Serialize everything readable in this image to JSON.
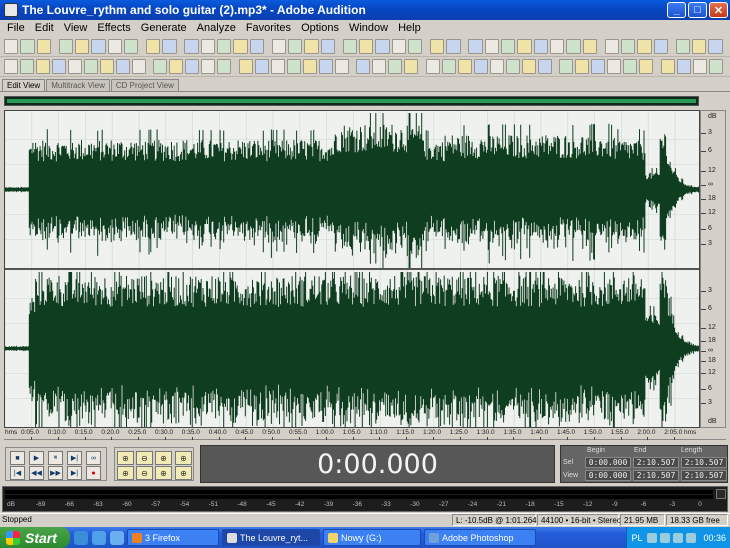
{
  "window": {
    "title": "The Louvre_rythm and solo guitar (2).mp3* - Adobe Audition",
    "minimize": "_",
    "maximize": "□",
    "close": "✕"
  },
  "menu": [
    "File",
    "Edit",
    "View",
    "Effects",
    "Generate",
    "Analyze",
    "Favorites",
    "Options",
    "Window",
    "Help"
  ],
  "tabs": [
    {
      "label": "Edit View",
      "active": true
    },
    {
      "label": "Multitrack View",
      "active": false
    },
    {
      "label": "CD Project View",
      "active": false
    }
  ],
  "waveform": {
    "color": "#0f3d1f",
    "background": "#eef1ee",
    "channels": [
      "left",
      "right"
    ]
  },
  "db_ruler": {
    "unit": "dB",
    "left_channel": [
      "3",
      "6",
      "12",
      "∞",
      "18",
      "12",
      "6",
      "3"
    ],
    "right_channel": [
      "3",
      "6",
      "12",
      "18",
      "∞",
      "18",
      "12",
      "6",
      "3"
    ]
  },
  "time_ruler": {
    "start": "hms",
    "end": "hms",
    "labels": [
      "0:05.0",
      "0:10.0",
      "0:15.0",
      "0:20.0",
      "0:25.0",
      "0:30.0",
      "0:35.0",
      "0:40.0",
      "0:45.0",
      "0:50.0",
      "0:55.0",
      "1:00.0",
      "1:05.0",
      "1:10.0",
      "1:15.0",
      "1:20.0",
      "1:25.0",
      "1:30.0",
      "1:35.0",
      "1:40.0",
      "1:45.0",
      "1:50.0",
      "1:55.0",
      "2:00.0",
      "2:05.0"
    ]
  },
  "transport": {
    "row1": [
      "■",
      "▶",
      "⏸",
      "▶|",
      "∞"
    ],
    "row2": [
      "|◀",
      "◀◀",
      "▶▶",
      "▶|",
      "●"
    ]
  },
  "zoom": {
    "row1": [
      "⊕",
      "⊖",
      "⊕",
      "⊕"
    ],
    "row2": [
      "⊕",
      "⊖",
      "⊕",
      "⊕"
    ]
  },
  "time_display": "0:00.000",
  "selection": {
    "headers": {
      "begin": "Begin",
      "end": "End",
      "length": "Length"
    },
    "sel": {
      "label": "Sel",
      "begin": "0:00.000",
      "end": "2:10.507",
      "length": "2:10.507"
    },
    "view": {
      "label": "View",
      "begin": "0:00.000",
      "end": "2:10.507",
      "length": "2:10.507"
    }
  },
  "level_meter": {
    "labels": [
      "dB",
      "-69",
      "-66",
      "-63",
      "-60",
      "-57",
      "-54",
      "-51",
      "-48",
      "-45",
      "-42",
      "-39",
      "-36",
      "-33",
      "-30",
      "-27",
      "-24",
      "-21",
      "-18",
      "-15",
      "-12",
      "-9",
      "-6",
      "-3",
      "0"
    ]
  },
  "status": {
    "text": "Stopped",
    "level": "L: -10.5dB @  1:01.264",
    "format": "44100 • 16-bit • Stereo",
    "size": "21.95 MB",
    "free": "18.33 GB free"
  },
  "taskbar": {
    "start": "Start",
    "tasks": [
      {
        "label": "3 Firefox",
        "active": false
      },
      {
        "label": "The Louvre_ryt...",
        "active": true
      },
      {
        "label": "Nowy (G:)",
        "active": false
      },
      {
        "label": "Adobe Photoshop",
        "active": false
      }
    ],
    "language": "PL",
    "clock": "00:36"
  }
}
